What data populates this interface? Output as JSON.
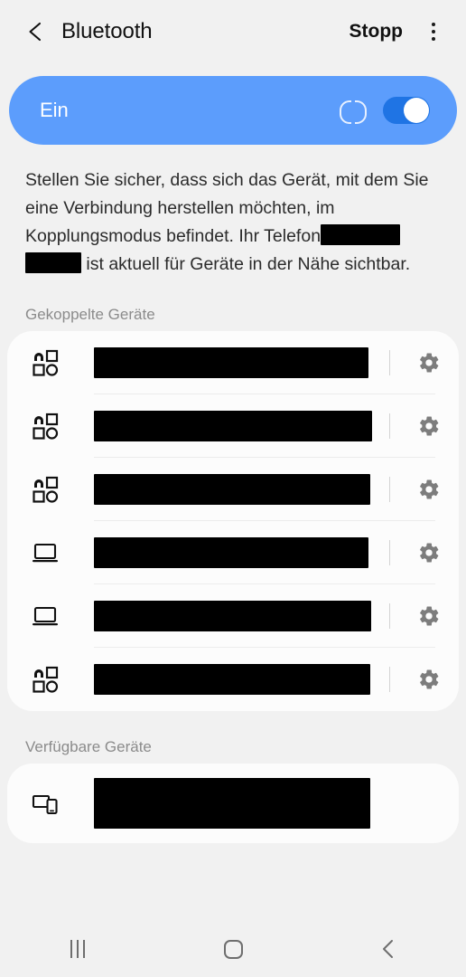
{
  "header": {
    "back_icon": "chevron-left-icon",
    "title": "Bluetooth",
    "action_label": "Stopp",
    "overflow_icon": "more-vertical-icon"
  },
  "banner": {
    "state_label": "Ein",
    "scanning_icon": "scanning-spinner-icon",
    "toggle_on": true,
    "toggle_icon": "toggle-switch-on-icon",
    "color": "#5c9dfc",
    "toggle_color": "#1f74e4"
  },
  "description": {
    "part1": "Stellen Sie sicher, dass sich das Gerät, mit dem Sie eine Verbindung herstellen möchten, im Kopplungsmodus befindet. Ihr Telefon",
    "part2": "ist aktuell für Geräte in der Nähe sichtbar."
  },
  "paired_section": {
    "label": "Gekoppelte Geräte",
    "devices": [
      {
        "icon": "unknown-device-icon",
        "name_redacted": true,
        "name_width": 304,
        "settings_icon": "gear-icon"
      },
      {
        "icon": "unknown-device-icon",
        "name_redacted": true,
        "name_width": 308,
        "settings_icon": "gear-icon"
      },
      {
        "icon": "unknown-device-icon",
        "name_redacted": true,
        "name_width": 306,
        "settings_icon": "gear-icon"
      },
      {
        "icon": "laptop-icon",
        "name_redacted": true,
        "name_width": 304,
        "settings_icon": "gear-icon"
      },
      {
        "icon": "laptop-icon",
        "name_redacted": true,
        "name_width": 307,
        "settings_icon": "gear-icon"
      },
      {
        "icon": "unknown-device-icon",
        "name_redacted": true,
        "name_width": 306,
        "settings_icon": "gear-icon"
      }
    ]
  },
  "available_section": {
    "label": "Verfügbare Geräte",
    "devices": [
      {
        "icon": "multi-device-icon",
        "name_redacted": true,
        "name_width": 306
      }
    ]
  },
  "navbar": {
    "recents_icon": "recents-icon",
    "home_icon": "home-icon",
    "back_icon": "back-chevron-icon"
  },
  "colors": {
    "background": "#f1f1f1",
    "card": "#fcfcfc",
    "accent": "#5c9dfc",
    "muted_text": "#8b8b8b",
    "redaction": "#000000"
  }
}
